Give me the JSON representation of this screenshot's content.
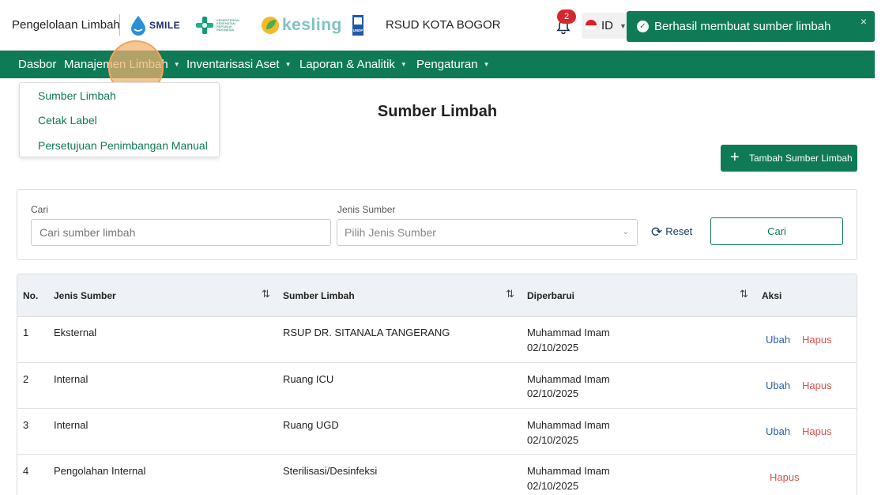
{
  "header": {
    "app_name": "Pengelolaan Limbah",
    "logos": {
      "smile": "SMILE",
      "kemenkes": "KEMENTERIAN KESEHATAN REPUBLIK INDONESIA",
      "kesling": "kesling",
      "undp": "UNDP"
    },
    "hospital": "RSUD KOTA BOGOR",
    "notification_count": "2",
    "language": "ID"
  },
  "toast": {
    "message": "Berhasil membuat sumber limbah",
    "close": "×"
  },
  "nav": {
    "items": [
      {
        "label": "Dasbor"
      },
      {
        "label": "Manajemen Limbah"
      },
      {
        "label": "Inventarisasi Aset"
      },
      {
        "label": "Laporan & Analitik"
      },
      {
        "label": "Pengaturan"
      }
    ]
  },
  "dropdown": {
    "items": [
      {
        "label": "Sumber Limbah"
      },
      {
        "label": "Cetak Label"
      },
      {
        "label": "Persetujuan Penimbangan Manual"
      }
    ]
  },
  "page": {
    "title": "Sumber Limbah",
    "add_button": "Tambah Sumber Limbah"
  },
  "filter": {
    "search_label": "Cari",
    "search_placeholder": "Cari sumber limbah",
    "type_label": "Jenis Sumber",
    "type_placeholder": "Pilih Jenis Sumber",
    "reset_label": "Reset",
    "search_button": "Cari"
  },
  "table": {
    "headers": {
      "no": "No.",
      "jenis": "Jenis Sumber",
      "sumber": "Sumber Limbah",
      "diperbarui": "Diperbarui",
      "aksi": "Aksi"
    },
    "rows": [
      {
        "no": "1",
        "jenis": "Eksternal",
        "sumber": "RSUP DR. SITANALA TANGERANG",
        "user": "Muhammad Imam",
        "date": "02/10/2025",
        "edit": "Ubah",
        "delete": "Hapus"
      },
      {
        "no": "2",
        "jenis": "Internal",
        "sumber": "Ruang ICU",
        "user": "Muhammad Imam",
        "date": "02/10/2025",
        "edit": "Ubah",
        "delete": "Hapus"
      },
      {
        "no": "3",
        "jenis": "Internal",
        "sumber": "Ruang UGD",
        "user": "Muhammad Imam",
        "date": "02/10/2025",
        "edit": "Ubah",
        "delete": "Hapus"
      },
      {
        "no": "4",
        "jenis": "Pengolahan Internal",
        "sumber": "Sterilisasi/Desinfeksi",
        "user": "Muhammad Imam",
        "date": "02/10/2025",
        "delete": "Hapus"
      }
    ]
  },
  "colors": {
    "primary": "#0f7a56",
    "danger": "#d9534f",
    "link": "#2c5f9e"
  }
}
